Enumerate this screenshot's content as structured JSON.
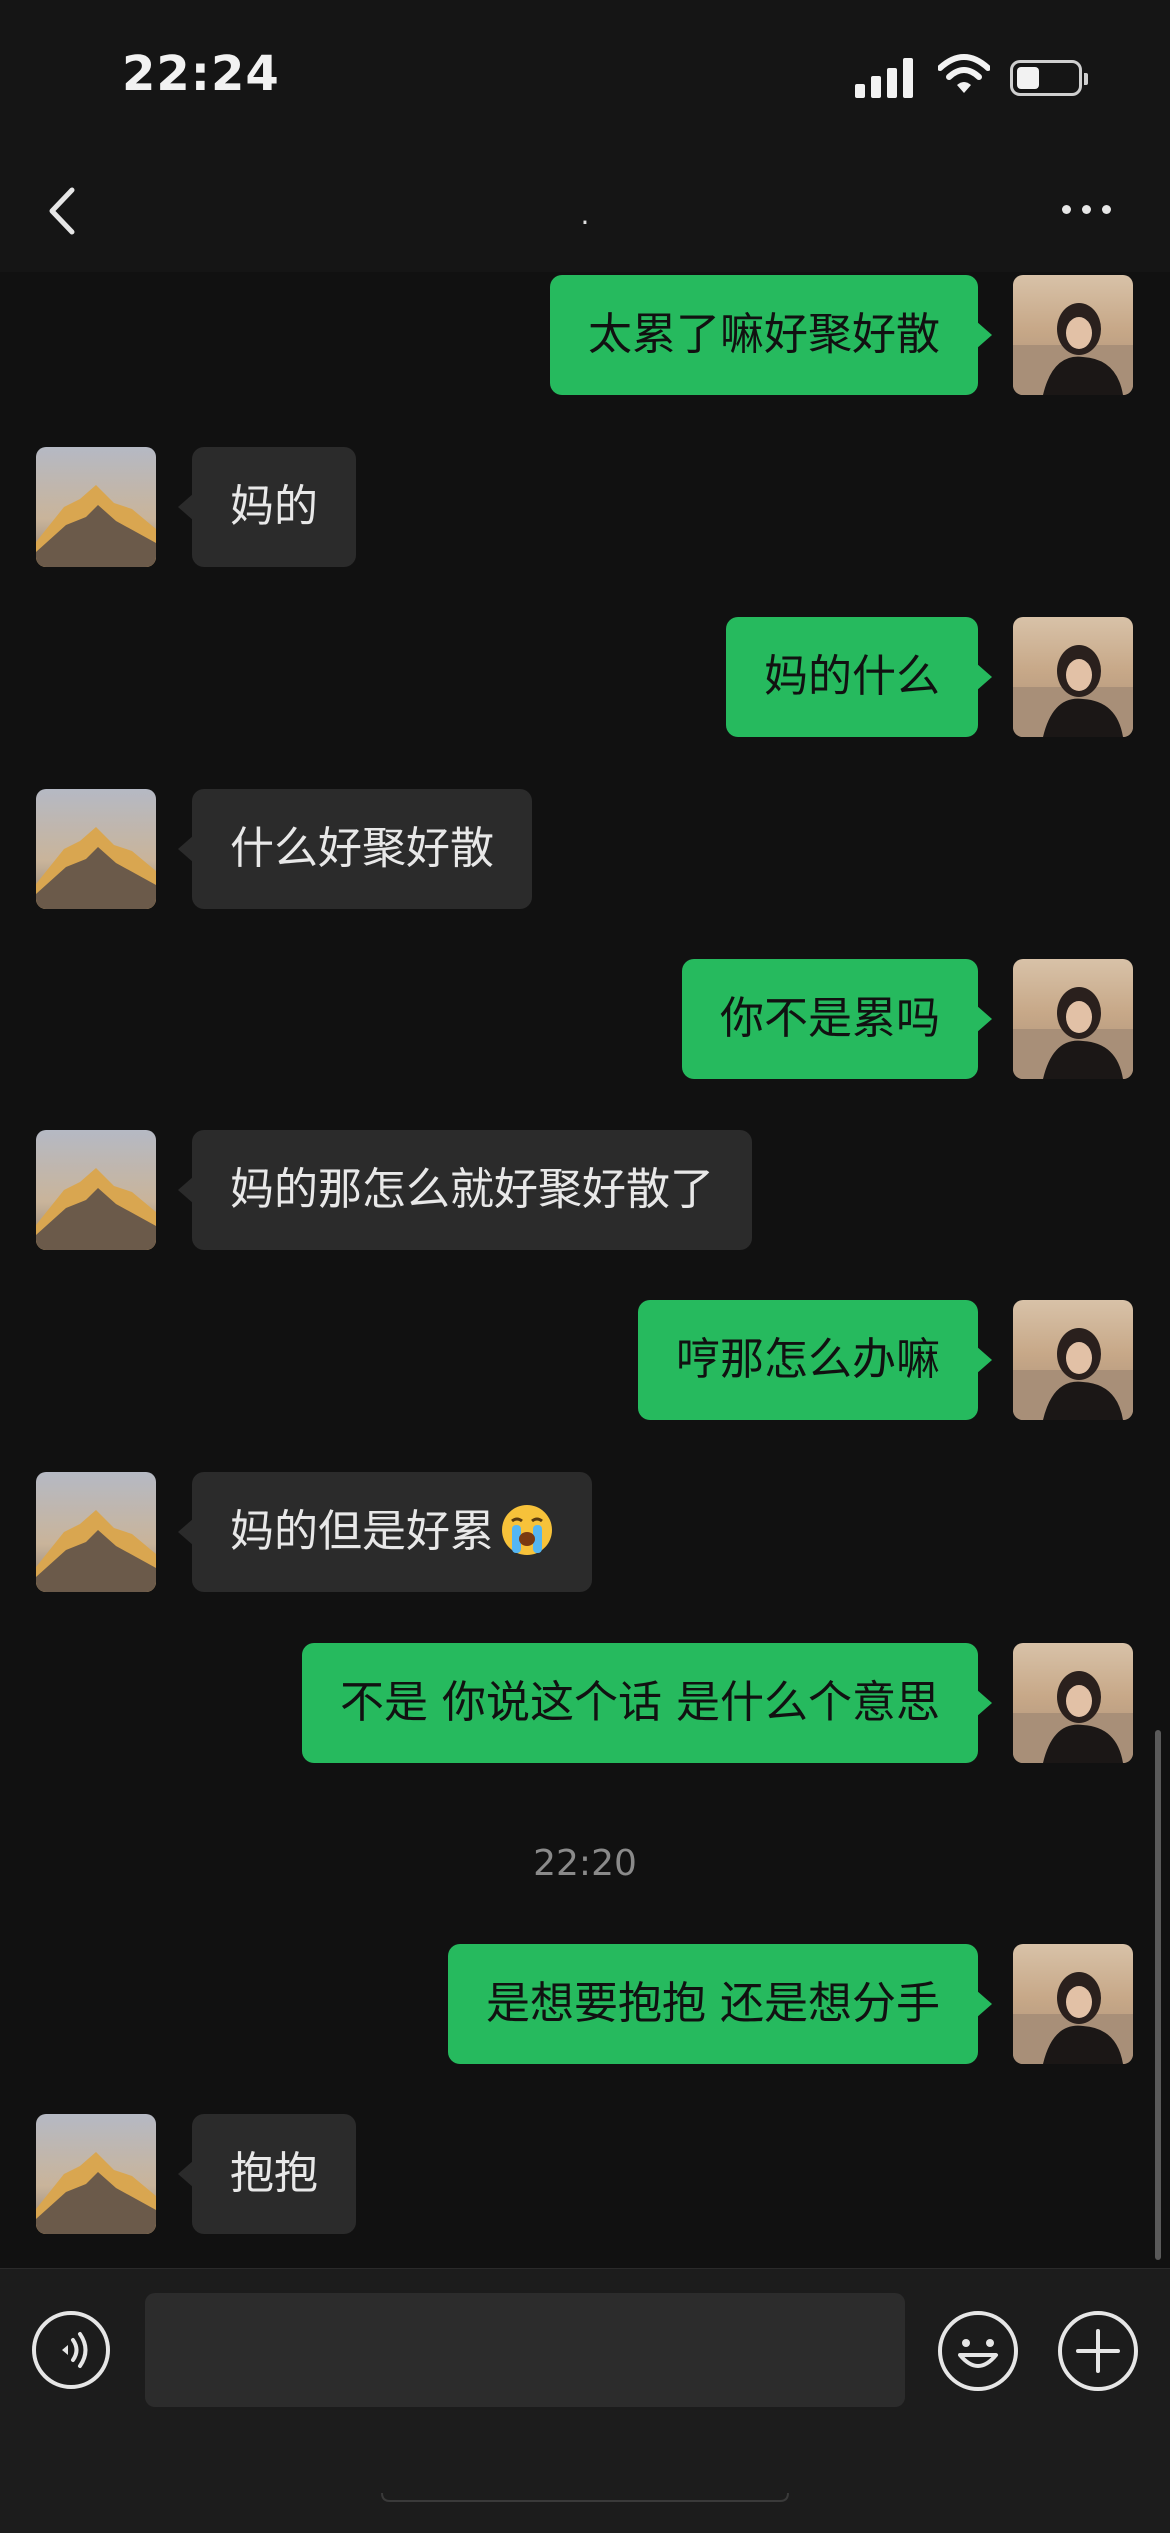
{
  "status_bar": {
    "time": "22:24"
  },
  "nav": {
    "title": "."
  },
  "messages": [
    {
      "side": "out",
      "text": "太累了嘛好聚好散"
    },
    {
      "side": "in",
      "text": "妈的"
    },
    {
      "side": "out",
      "text": "妈的什么"
    },
    {
      "side": "in",
      "text": "什么好聚好散"
    },
    {
      "side": "out",
      "text": "你不是累吗"
    },
    {
      "side": "in",
      "text": "妈的那怎么就好聚好散了"
    },
    {
      "side": "out",
      "text": "哼那怎么办嘛"
    },
    {
      "side": "in",
      "text": "妈的但是好累",
      "emoji": "loudly-crying-face"
    },
    {
      "side": "out",
      "text": "不是 你说这个话 是什么个意思"
    },
    {
      "side": "out",
      "text": "是想要抱抱 还是想分手"
    },
    {
      "side": "in",
      "text": "抱抱"
    }
  ],
  "timestamp": "22:20",
  "input": {
    "value": ""
  },
  "colors": {
    "background": "#111111",
    "outgoing_bubble": "#26ba5e",
    "incoming_bubble": "#2b2b2b",
    "input_bar": "#1c1c1c"
  },
  "icons": [
    "back-chevron-icon",
    "more-icon",
    "voice-icon",
    "emoji-icon",
    "plus-icon"
  ]
}
